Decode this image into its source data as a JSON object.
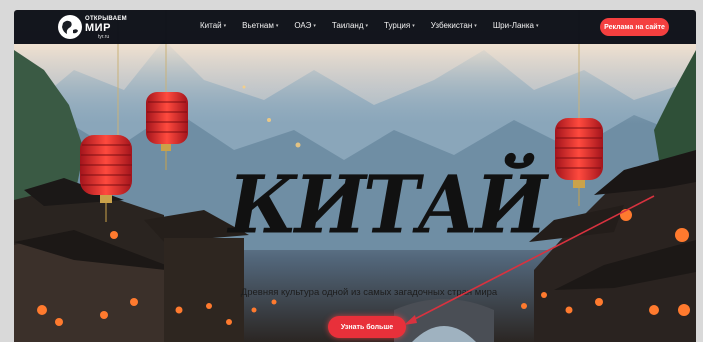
{
  "nav": {
    "logo": {
      "line1": "ОТКРЫВАЕМ",
      "line2": "МИР",
      "line3": "tyr.ru"
    },
    "items": [
      {
        "label": "Китай",
        "has_dropdown": true
      },
      {
        "label": "Вьетнам",
        "has_dropdown": true
      },
      {
        "label": "ОАЭ",
        "has_dropdown": true
      },
      {
        "label": "Таиланд",
        "has_dropdown": true
      },
      {
        "label": "Турция",
        "has_dropdown": true
      },
      {
        "label": "Узбекистан",
        "has_dropdown": true
      },
      {
        "label": "Шри-Ланка",
        "has_dropdown": true
      }
    ],
    "cta_label": "Реклама на сайте"
  },
  "hero": {
    "title": "КИТАЙ",
    "subtitle": "Древняя культура одной из самых загадочных стран мира",
    "button_label": "Узнать больше"
  },
  "colors": {
    "accent": "#f43f3f",
    "nav_bg": "#0a0e16",
    "annotation_arrow": "#d8323f"
  },
  "icons": [
    "globe-icon",
    "chevron-down-icon",
    "lantern-decoration",
    "annotation-arrow"
  ]
}
